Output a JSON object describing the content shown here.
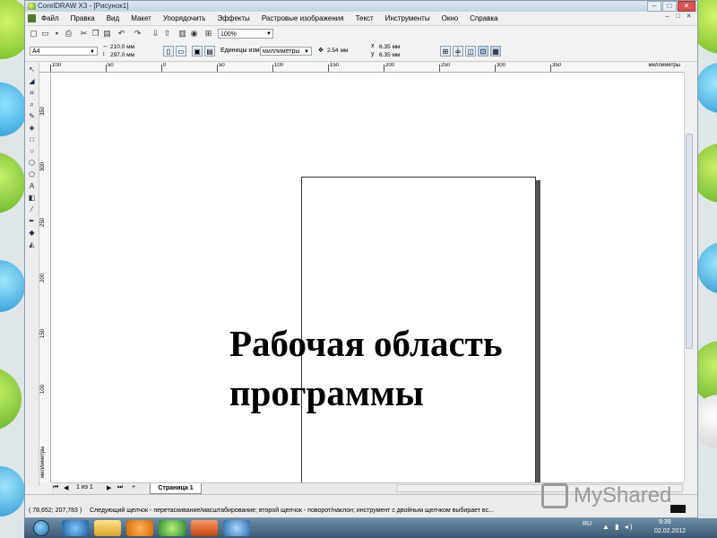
{
  "window": {
    "title": "CorelDRAW X3 - [Рисунок1]",
    "controls": [
      "–",
      "□",
      "✕"
    ],
    "mdi_controls": [
      "–",
      "□",
      "✕"
    ]
  },
  "menu": [
    "Файл",
    "Правка",
    "Вид",
    "Макет",
    "Упорядочить",
    "Эффекты",
    "Растровые изображения",
    "Текст",
    "Инструменты",
    "Окно",
    "Справка"
  ],
  "toolbar": {
    "zoom": "100%"
  },
  "propbar": {
    "paper_size": "A4",
    "width": "210.0 мм",
    "height": "297.0 мм",
    "units_label": "Единицы измерения:",
    "units_value": "миллиметры",
    "nudge": "2.54 мм",
    "dup_x": "6.35 мм",
    "dup_y": "6.35 мм"
  },
  "ruler_h": {
    "labels": [
      "100",
      "50",
      "0",
      "50",
      "100",
      "150",
      "200",
      "250",
      "300",
      "350"
    ],
    "unit": "миллиметры"
  },
  "ruler_v": {
    "labels": [
      "350",
      "300",
      "250",
      "200",
      "150",
      "100"
    ],
    "unit": "миллиметры"
  },
  "pagenav": {
    "count": "1 из 1",
    "tab": "Страница 1"
  },
  "status": {
    "coords": "( 78,652; 207,783 )",
    "hint": "Следующий щелчок - перетаскивание/масштабирование; второй щелчок - поворот/наклон; инструмент с двойным щелчком выбирает вс..."
  },
  "taskbar": {
    "lang": "RU",
    "time": "9:39",
    "date": "02.02.2012"
  },
  "overlay": {
    "line1": "Рабочая область",
    "line2": "программы"
  },
  "watermark": {
    "text": "MyShared"
  },
  "palette_colors": [
    "#ffffff",
    "#000000",
    "#1a1a1a",
    "#333333",
    "#4d4d4d",
    "#666666",
    "#808080",
    "#999999",
    "#b3b3b3",
    "#cccccc",
    "#e6e6e6",
    "#ffffff",
    "#0033cc",
    "#3366ff",
    "#00a651",
    "#ffcc00",
    "#ffff00",
    "#ff0000",
    "#ff3399",
    "#cc0066",
    "#ff6600",
    "#ff9933",
    "#ffcc99",
    "#cc99ff",
    "#9966cc",
    "#6633cc",
    "#993399",
    "#996633",
    "#cc9966",
    "#999966",
    "#669999",
    "#66cccc",
    "#3399cc",
    "#006699",
    "#336699",
    "#99ccff",
    "#ccffff",
    "#99cc99",
    "#669966",
    "#336633",
    "#009966",
    "#00cc99",
    "#66ffcc",
    "#006666",
    "#003366",
    "#330066",
    "#663399",
    "#cc66cc",
    "#ffccff",
    "#ff99cc",
    "#cc3366",
    "#993333",
    "#663300",
    "#996600",
    "#cc9900",
    "#ffcc66",
    "#ffffcc",
    "#ccff99",
    "#99ff66",
    "#66cc33",
    "#339900",
    "#006600",
    "#003300"
  ]
}
